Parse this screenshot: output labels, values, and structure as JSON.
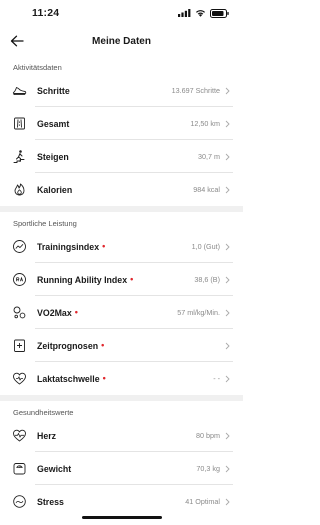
{
  "status": {
    "time": "11:24"
  },
  "header": {
    "title": "Meine Daten"
  },
  "sections": [
    {
      "title": "Aktivitätsdaten",
      "rows": [
        {
          "label": "Schritte",
          "value": "13.697 Schritte",
          "icon": "shoe-icon",
          "dot": false
        },
        {
          "label": "Gesamt",
          "value": "12,50 km",
          "icon": "route-icon",
          "dot": false
        },
        {
          "label": "Steigen",
          "value": "30,7 m",
          "icon": "climb-icon",
          "dot": false
        },
        {
          "label": "Kalorien",
          "value": "984 kcal",
          "icon": "flame-icon",
          "dot": false
        }
      ]
    },
    {
      "title": "Sportliche Leistung",
      "rows": [
        {
          "label": "Trainingsindex",
          "value": "1,0 (Gut)",
          "icon": "trend-icon",
          "dot": true
        },
        {
          "label": "Running Ability Index",
          "value": "38,6 (B)",
          "icon": "ra-icon",
          "dot": true
        },
        {
          "label": "VO2Max",
          "value": "57 ml/kg/Min.",
          "icon": "bubbles-icon",
          "dot": true
        },
        {
          "label": "Zeitprognosen",
          "value": "",
          "icon": "clock-document-icon",
          "dot": true
        },
        {
          "label": "Laktatschwelle",
          "value": "- -",
          "icon": "heart-pulse-icon",
          "dot": true
        }
      ]
    },
    {
      "title": "Gesundheitswerte",
      "rows": [
        {
          "label": "Herz",
          "value": "80 bpm",
          "icon": "heart-icon",
          "dot": false
        },
        {
          "label": "Gewicht",
          "value": "70,3 kg",
          "icon": "scale-icon",
          "dot": false
        },
        {
          "label": "Stress",
          "value": "41 Optimal",
          "icon": "stress-icon",
          "dot": false
        }
      ]
    }
  ],
  "colors": {
    "dot": "#e0262c",
    "divider": "#f0f0f0",
    "value": "#8a8a8a"
  }
}
